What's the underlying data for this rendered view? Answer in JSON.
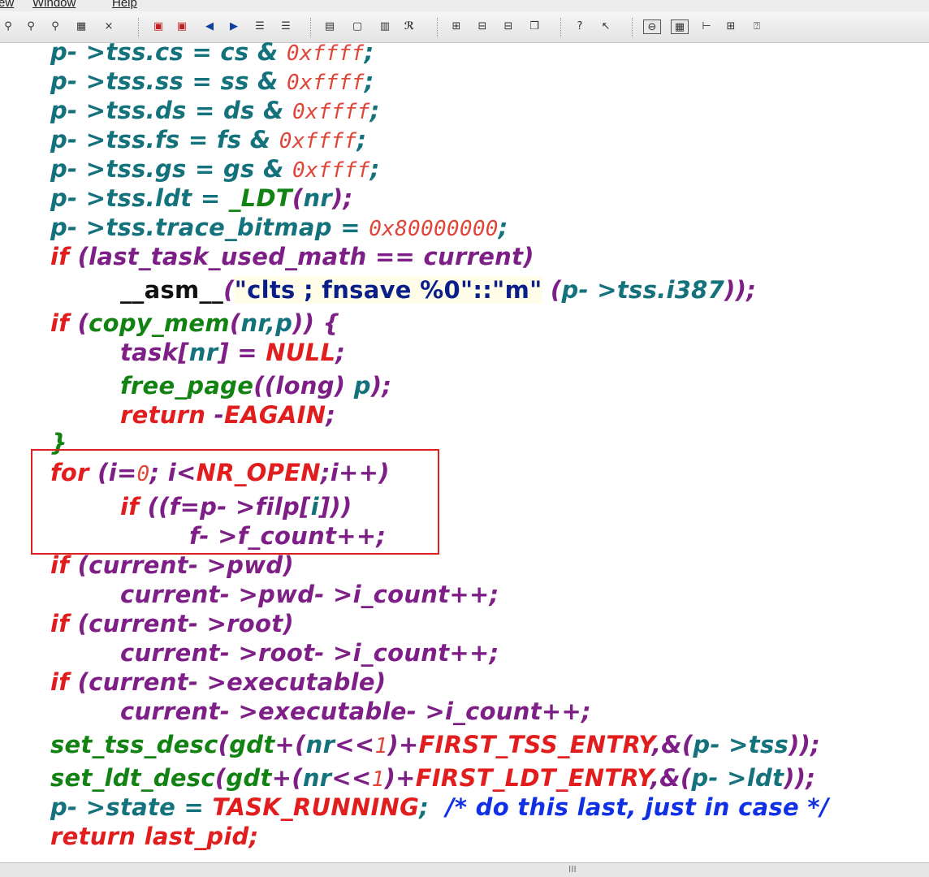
{
  "menu": {
    "view": "ew",
    "window": "Window",
    "help": "Help"
  },
  "toolbar_icons": [
    "find-icon",
    "find-prev-icon",
    "find-next-icon",
    "replace-icon",
    "search-replace-icon",
    "bookmark-icon",
    "bookmark-next-icon",
    "back-arrow-icon",
    "forward-arrow-icon",
    "indent-icon",
    "outdent-icon",
    "file-icon",
    "new-file-icon",
    "book-icon",
    "relation-icon",
    "tile-icon",
    "window-horizontal-icon",
    "window-vertical-icon",
    "cascade-icon",
    "context-help-icon",
    "pointer-help-icon",
    "toggle-view-icon",
    "symbol-window-icon",
    "tree-icon",
    "relation-graph-icon",
    "info-icon"
  ],
  "code_lines": [
    "p->tss.cs = cs & 0xffff;",
    "p->tss.ss = ss & 0xffff;",
    "p->tss.ds = ds & 0xffff;",
    "p->tss.fs = fs & 0xffff;",
    "p->tss.gs = gs & 0xffff;",
    "p->tss.ldt = _LDT(nr);",
    "p->tss.trace_bitmap = 0x80000000;",
    "if (last_task_used_math == current)",
    "__asm__(\"clts ; fnsave %0\"::\"m\" (p->tss.i387));",
    "if (copy_mem(nr,p)) {",
    "task[nr] = NULL;",
    "free_page((long) p);",
    "return -EAGAIN;",
    "}",
    "for (i=0; i<NR_OPEN;i++)",
    "if ((f=p->filp[i]))",
    "f->f_count++;",
    "if (current->pwd)",
    "current->pwd->i_count++;",
    "if (current->root)",
    "current->root->i_count++;",
    "if (current->executable)",
    "current->executable->i_count++;",
    "set_tss_desc(gdt+(nr<<1)+FIRST_TSS_ENTRY,&(p->tss));",
    "set_ldt_desc(gdt+(nr<<1)+FIRST_LDT_ENTRY,&(p->ldt));",
    "p->state = TASK_RUNNING; /* do this last, just in case */",
    "return last_pid;"
  ],
  "code_tokens": {
    "cs": [
      "p- >tss.cs = cs & ",
      "0xffff",
      ";"
    ],
    "ss": [
      "p- >tss.ss = ss & ",
      "0xffff",
      ";"
    ],
    "ds": [
      "p- >tss.ds = ds & ",
      "0xffff",
      ";"
    ],
    "fs": [
      "p- >tss.fs = fs & ",
      "0xffff",
      ";"
    ],
    "gs": [
      "p- >tss.gs = gs & ",
      "0xffff",
      ";"
    ],
    "ldt": [
      "p- >tss.ldt = ",
      "_LDT",
      "(",
      "nr",
      ");"
    ],
    "trace": [
      "p- >tss.trace_bitmap = ",
      "0x80000000",
      ";"
    ],
    "if_math": [
      "if ",
      "(last_task_used_math == current)"
    ],
    "asm": [
      "__asm__",
      "(",
      "\"clts ; fnsave %0\"::\"m\"",
      " (",
      "p- >tss.i387",
      "));"
    ],
    "if_copy": [
      "if ",
      "(",
      "copy_mem",
      "(",
      "nr,p",
      ")) {"
    ],
    "task": [
      "task",
      "[",
      "nr",
      "] = ",
      "NULL",
      ";"
    ],
    "free": [
      "free_page",
      "((",
      "long",
      ") ",
      "p",
      ");"
    ],
    "ret": [
      "return",
      " -",
      "EAGAIN",
      ";"
    ],
    "close": [
      "}"
    ],
    "for": [
      "for ",
      "(",
      "i=",
      "0",
      "; i<",
      "NR_OPEN",
      ";i++)"
    ],
    "if_f": [
      "if ",
      "((",
      "f=p- >filp[",
      "i",
      "]))"
    ],
    "fcount": [
      "f- >f_count++;"
    ],
    "if_pwd": [
      "if ",
      "(current- >pwd)"
    ],
    "pwd": [
      "current- >pwd- >i_count++;"
    ],
    "if_root": [
      "if ",
      "(current- >root)"
    ],
    "root": [
      "current- >root- >i_count++;"
    ],
    "if_exe": [
      "if ",
      "(current- >executable)"
    ],
    "exe": [
      "current- >executable- >i_count++;"
    ],
    "tss_desc": [
      "set_tss_desc",
      "(",
      "gdt",
      "+(",
      "nr",
      "<<",
      "1",
      ")+",
      "FIRST_TSS_ENTRY",
      ",&(",
      "p- >tss",
      "));"
    ],
    "ldt_desc": [
      "set_ldt_desc",
      "(",
      "gdt",
      "+(",
      "nr",
      "<<",
      "1",
      ")+",
      "FIRST_LDT_ENTRY",
      ",&(",
      "p- >ldt",
      "));"
    ],
    "state": [
      "p- >state = ",
      "TASK_RUNNING",
      ";",
      "  /* do this last, just in case */"
    ],
    "last": [
      "return last_pid;"
    ]
  },
  "colors": {
    "identifier": "#14727c",
    "function": "#128312",
    "keyword": "#e21d1d",
    "operator": "#7d1f86",
    "number": "#e0453a",
    "comment": "#1030e6",
    "highlight_box": "#e02020"
  },
  "status": {
    "grip": "III"
  }
}
